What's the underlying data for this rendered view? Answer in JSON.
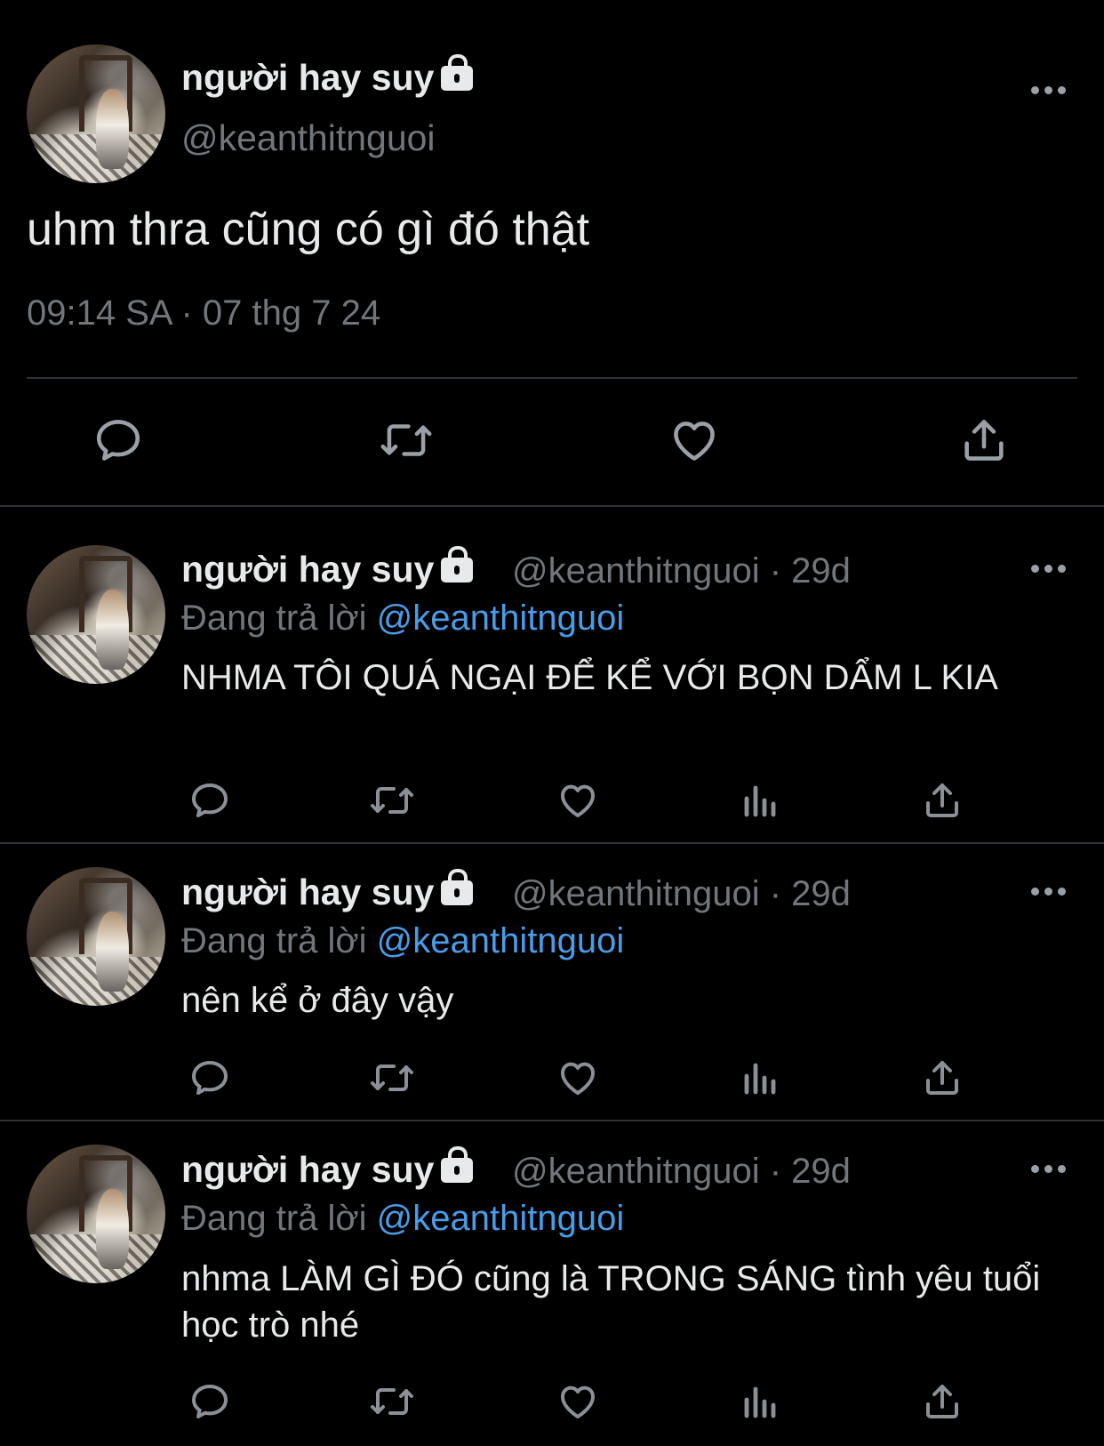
{
  "main_tweet": {
    "display_name": "người hay suy",
    "handle": "@keanthitnguoi",
    "text": "uhm thra cũng có gì đó thật",
    "timestamp": "09:14 SA · 07 thg 7 24"
  },
  "replies": [
    {
      "display_name": "người hay suy",
      "handle": "@keanthitnguoi",
      "age": "· 29d",
      "replying_label": "Đang trả lời",
      "replying_to": "@keanthitnguoi",
      "text": "NHMA TÔI QUÁ NGẠI ĐỂ KỂ VỚI BỌN DẨM L KIA"
    },
    {
      "display_name": "người hay suy",
      "handle": "@keanthitnguoi",
      "age": "· 29d",
      "replying_label": "Đang trả lời",
      "replying_to": "@keanthitnguoi",
      "text": "nên kể ở đây vậy"
    },
    {
      "display_name": "người hay suy",
      "handle": "@keanthitnguoi",
      "age": "· 29d",
      "replying_label": "Đang trả lời",
      "replying_to": "@keanthitnguoi",
      "text": "nhma LÀM GÌ ĐÓ cũng là TRONG SÁNG tình yêu tuổi học trò nhé"
    }
  ],
  "icons": {
    "protected": "lock-icon",
    "more": "more-icon",
    "reply": "reply-icon",
    "retweet": "retweet-icon",
    "like": "like-icon",
    "views": "views-icon",
    "share": "share-icon"
  },
  "colors": {
    "background": "#000000",
    "text": "#e7e9ea",
    "secondary": "#71767b",
    "mention": "#4a9ce8",
    "divider": "#2f3336"
  }
}
